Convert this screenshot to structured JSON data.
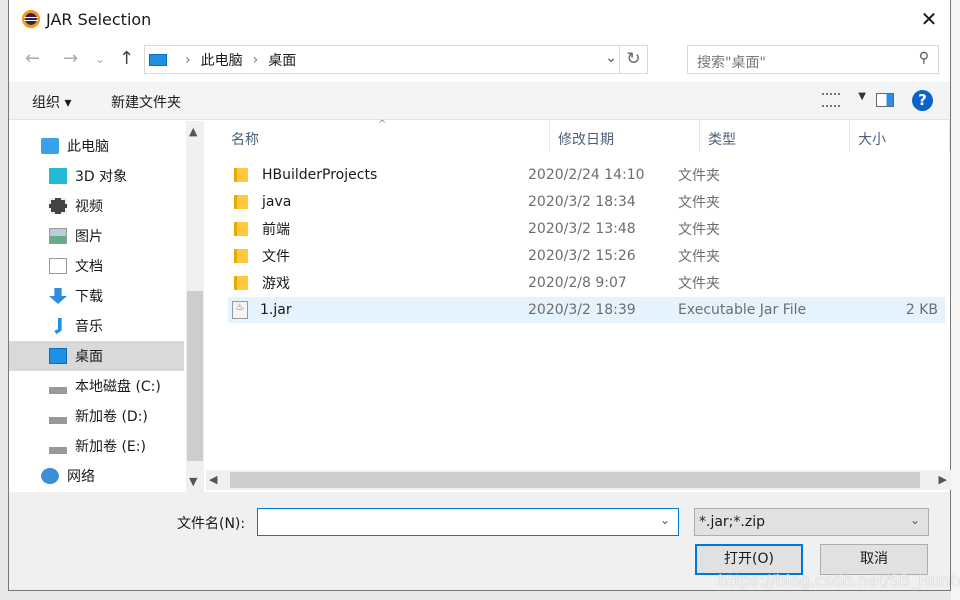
{
  "window": {
    "title": "JAR Selection"
  },
  "address": {
    "crumbs": [
      "此电脑",
      "桌面"
    ]
  },
  "search": {
    "placeholder": "搜索\"桌面\""
  },
  "toolbar": {
    "organize": "组织 ▾",
    "new_folder": "新建文件夹",
    "help": "?"
  },
  "nav_pane": {
    "items": [
      {
        "label": "此电脑",
        "icon": "computer-icon"
      },
      {
        "label": "3D 对象",
        "icon": "cube-icon"
      },
      {
        "label": "视频",
        "icon": "video-icon"
      },
      {
        "label": "图片",
        "icon": "picture-icon"
      },
      {
        "label": "文档",
        "icon": "document-icon"
      },
      {
        "label": "下载",
        "icon": "download-icon"
      },
      {
        "label": "音乐",
        "icon": "music-icon"
      },
      {
        "label": "桌面",
        "icon": "desktop-icon",
        "selected": true
      },
      {
        "label": "本地磁盘 (C:)",
        "icon": "drive-icon"
      },
      {
        "label": "新加卷 (D:)",
        "icon": "drive-icon"
      },
      {
        "label": "新加卷 (E:)",
        "icon": "drive-icon"
      },
      {
        "label": "网络",
        "icon": "network-icon"
      }
    ]
  },
  "columns": [
    "名称",
    "修改日期",
    "类型",
    "大小"
  ],
  "files": [
    {
      "name": "HBuilderProjects",
      "modified": "2020/2/24 14:10",
      "type": "文件夹",
      "size": ""
    },
    {
      "name": "java",
      "modified": "2020/3/2 18:34",
      "type": "文件夹",
      "size": ""
    },
    {
      "name": "前端",
      "modified": "2020/3/2 13:48",
      "type": "文件夹",
      "size": ""
    },
    {
      "name": "文件",
      "modified": "2020/3/2 15:26",
      "type": "文件夹",
      "size": ""
    },
    {
      "name": "游戏",
      "modified": "2020/2/8 9:07",
      "type": "文件夹",
      "size": ""
    },
    {
      "name": "1.jar",
      "modified": "2020/3/2 18:39",
      "type": "Executable Jar File",
      "size": "2 KB",
      "selected": true
    }
  ],
  "footer": {
    "filename_label": "文件名(N):",
    "filename_value": "",
    "filter": "*.jar;*.zip",
    "open": "打开(O)",
    "cancel": "取消"
  },
  "watermark": "https://blog.csdn.net/SB_Hunter"
}
